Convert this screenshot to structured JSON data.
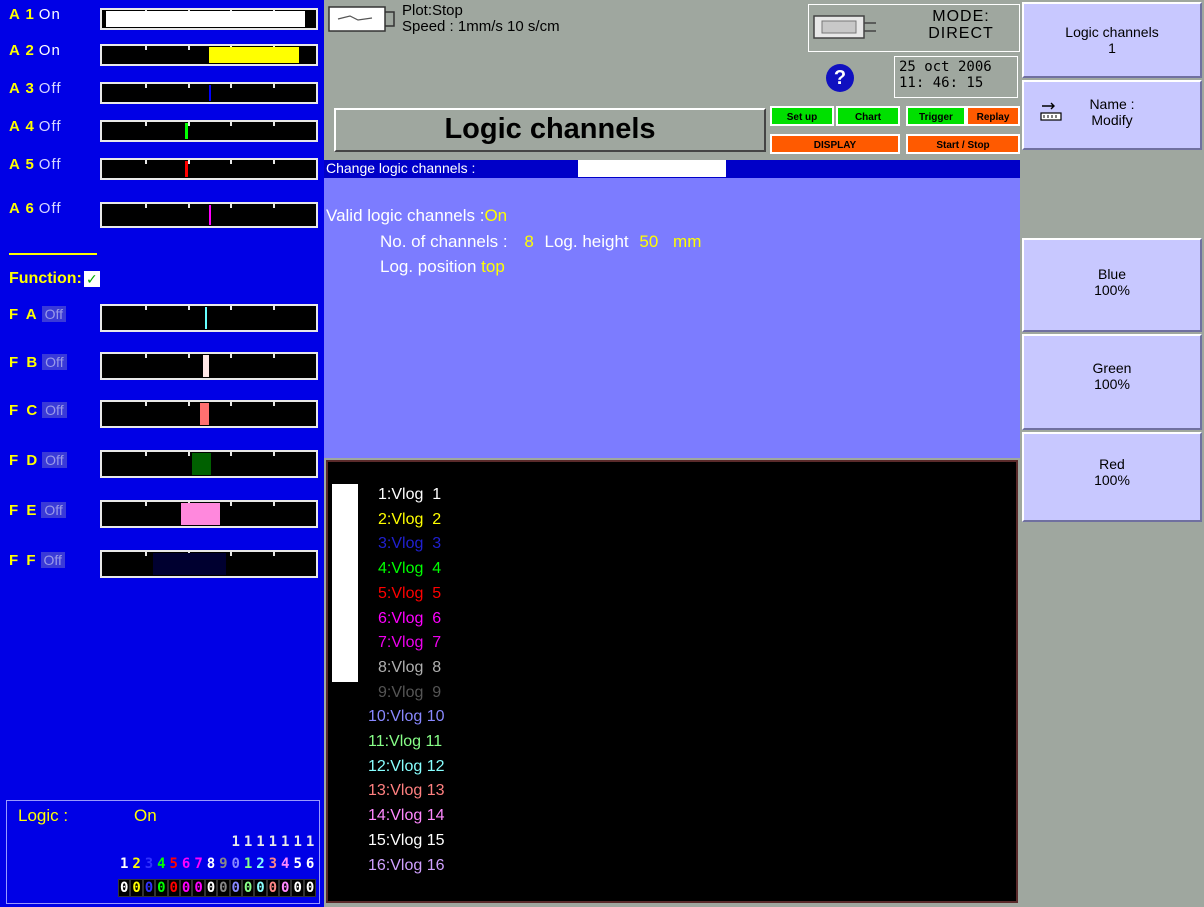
{
  "analog_channels": [
    {
      "id": "A 1",
      "state": "On",
      "mark_color": "#ffffff",
      "mark_start": 0.02,
      "mark_width": 0.93
    },
    {
      "id": "A 2",
      "state": "On",
      "mark_color": "#ffff00",
      "mark_start": 0.5,
      "mark_width": 0.42
    },
    {
      "id": "A 3",
      "state": "Off",
      "mark_color": "#0000ff",
      "mark_start": 0.5,
      "mark_width": 0.01
    },
    {
      "id": "A 4",
      "state": "Off",
      "mark_color": "#00ff00",
      "mark_start": 0.39,
      "mark_width": 0.01
    },
    {
      "id": "A 5",
      "state": "Off",
      "mark_color": "#ff0000",
      "mark_start": 0.39,
      "mark_width": 0.01
    },
    {
      "id": "A 6",
      "state": "Off",
      "mark_color": "#ff00ff",
      "mark_start": 0.5,
      "mark_width": 0.01
    }
  ],
  "function_label": "Function:",
  "function_check": "✓",
  "function_channels": [
    {
      "id": "F A",
      "state": "Off",
      "mark_color": "#66ffff",
      "mark_start": 0.48,
      "mark_width": 0.01
    },
    {
      "id": "F B",
      "state": "Off",
      "mark_color": "#ffe8e8",
      "mark_start": 0.47,
      "mark_width": 0.03
    },
    {
      "id": "F C",
      "state": "Off",
      "mark_color": "#ff7070",
      "mark_start": 0.46,
      "mark_width": 0.04
    },
    {
      "id": "F D",
      "state": "Off",
      "mark_color": "#006000",
      "mark_start": 0.42,
      "mark_width": 0.09
    },
    {
      "id": "F E",
      "state": "Off",
      "mark_color": "#ff88dd",
      "mark_start": 0.37,
      "mark_width": 0.18
    },
    {
      "id": "F F",
      "state": "Off",
      "mark_color": "#000030",
      "mark_start": 0.24,
      "mark_width": 0.34
    }
  ],
  "logic": {
    "label": "Logic :",
    "state": "On",
    "tens": [
      "",
      "",
      "",
      "",
      "",
      "",
      "",
      "",
      "",
      "1",
      "1",
      "1",
      "1",
      "1",
      "1",
      "1"
    ],
    "ones": [
      "1",
      "2",
      "3",
      "4",
      "5",
      "6",
      "7",
      "8",
      "9",
      "0",
      "1",
      "2",
      "3",
      "4",
      "5",
      "6"
    ],
    "values": [
      "0",
      "0",
      "0",
      "0",
      "0",
      "0",
      "0",
      "0",
      "0",
      "0",
      "0",
      "0",
      "0",
      "0",
      "0",
      "0"
    ],
    "colors": [
      "#ffffff",
      "#ffff00",
      "#3030ff",
      "#00ff00",
      "#ff0000",
      "#ff00ff",
      "#ff00ff",
      "#ffffff",
      "#888888",
      "#8888ff",
      "#88ff88",
      "#88ffff",
      "#ff8888",
      "#ff88ff",
      "#ffffff",
      "#ffffff"
    ]
  },
  "status": {
    "plot_line1": "Plot:Stop",
    "plot_line2": "Speed : 1mm/s 10 s/cm",
    "mode_line1": "MODE:",
    "mode_line2": "DIRECT",
    "date": "25 oct 2006",
    "time": "11: 46: 15",
    "help_symbol": "?"
  },
  "title": "Logic channels",
  "menu": {
    "setup": "Set up",
    "chart": "Chart",
    "trigger": "Trigger",
    "replay": "Replay",
    "display": "DISPLAY",
    "start_stop": "Start / Stop"
  },
  "config": {
    "change_label": "Change logic channels :",
    "change_value": "",
    "valid_label": "Valid logic channels :",
    "valid_value": "On",
    "nb_label": "No. of channels :",
    "nb_value": "8",
    "height_label": "Log. height",
    "height_value": "50",
    "height_unit": "mm",
    "position_label": "Log. position",
    "position_value": "top"
  },
  "preview_channels": [
    {
      "label": "1:Vlog  1",
      "color": "#ffffff"
    },
    {
      "label": "2:Vlog  2",
      "color": "#ffff00"
    },
    {
      "label": "3:Vlog  3",
      "color": "#2020d0"
    },
    {
      "label": "4:Vlog  4",
      "color": "#00ff00"
    },
    {
      "label": "5:Vlog  5",
      "color": "#ff0000"
    },
    {
      "label": "6:Vlog  6",
      "color": "#ff00ff"
    },
    {
      "label": "7:Vlog  7",
      "color": "#ee00ee"
    },
    {
      "label": "8:Vlog  8",
      "color": "#b0b0b0"
    },
    {
      "label": "9:Vlog  9",
      "color": "#555555"
    },
    {
      "label": "10:Vlog 10",
      "color": "#8888ff"
    },
    {
      "label": "11:Vlog 11",
      "color": "#88ff88"
    },
    {
      "label": "12:Vlog 12",
      "color": "#88ffff"
    },
    {
      "label": "13:Vlog 13",
      "color": "#ff8080"
    },
    {
      "label": "14:Vlog 14",
      "color": "#ff88ff"
    },
    {
      "label": "15:Vlog 15",
      "color": "#ffffff"
    },
    {
      "label": "16:Vlog 16",
      "color": "#d0a0ff"
    }
  ],
  "softkeys": {
    "k1_line1": "Logic channels",
    "k1_line2": "1",
    "k2_line1": "Name :",
    "k2_line2": "Modify",
    "k4_line1": "Blue",
    "k4_line2": "100%",
    "k5_line1": "Green",
    "k5_line2": "100%",
    "k6_line1": "Red",
    "k6_line2": "100%"
  }
}
